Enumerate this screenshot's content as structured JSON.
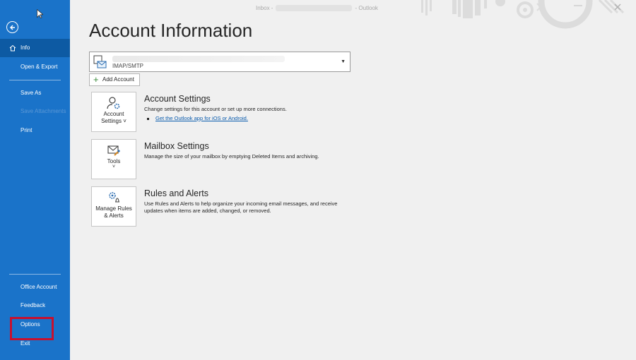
{
  "titlebar": {
    "left": "Inbox -",
    "right": "- Outlook"
  },
  "sidebar": {
    "back_label": "Back",
    "items": {
      "info": "Info",
      "open_export": "Open & Export",
      "save_as": "Save As",
      "save_attachments": "Save Attachments",
      "print": "Print",
      "office_account": "Office Account",
      "feedback": "Feedback",
      "options": "Options",
      "exit": "Exit"
    }
  },
  "main": {
    "title": "Account Information",
    "account": {
      "type": "IMAP/SMTP"
    },
    "add_account": "Add Account",
    "sections": {
      "account_settings": {
        "tile_label_1": "Account",
        "tile_label_2": "Settings",
        "title": "Account Settings",
        "desc": "Change settings for this account or set up more connections.",
        "link": "Get the Outlook app for iOS or Android."
      },
      "mailbox_settings": {
        "tile_label": "Tools",
        "title": "Mailbox Settings",
        "desc": "Manage the size of your mailbox by emptying Deleted Items and archiving."
      },
      "rules_alerts": {
        "tile_label_1": "Manage Rules",
        "tile_label_2": "& Alerts",
        "title": "Rules and Alerts",
        "desc": "Use Rules and Alerts to help organize your incoming email messages, and receive updates when items are added, changed, or removed."
      }
    }
  },
  "colors": {
    "sidebar": "#1a73c9",
    "sidebar_active": "#0d5aa3",
    "highlight": "#c8102e",
    "link": "#0b5cad"
  }
}
